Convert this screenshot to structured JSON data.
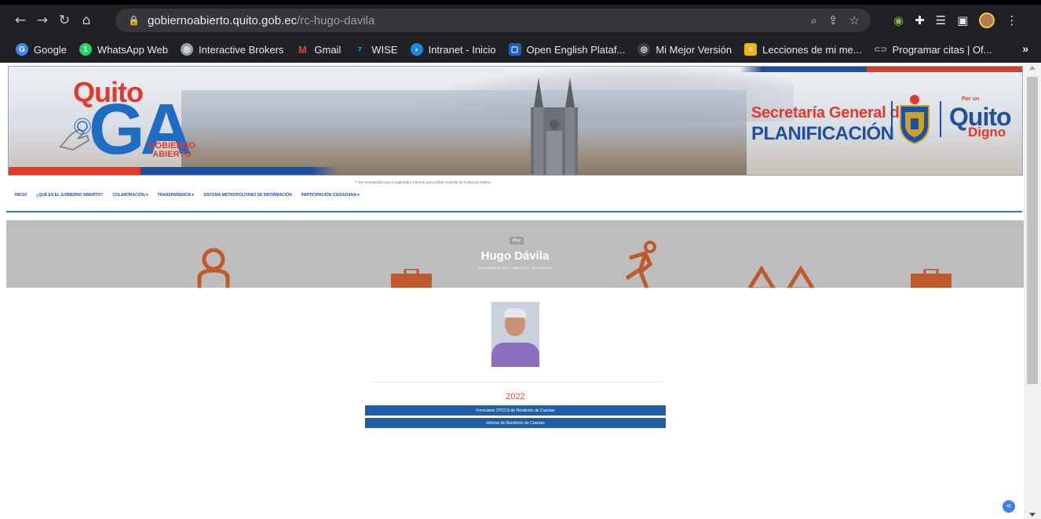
{
  "browser": {
    "url_host": "gobiernoabierto.quito.gob.ec",
    "url_path": "/rc-hugo-davila",
    "bookmarks": [
      {
        "label": "Google",
        "color": "#4285f4"
      },
      {
        "label": "WhatsApp Web",
        "color": "#25d366"
      },
      {
        "label": "Interactive Brokers",
        "color": "#9aa0a6"
      },
      {
        "label": "Gmail",
        "color": "#ea4335"
      },
      {
        "label": "WISE",
        "color": "#00b9ff"
      },
      {
        "label": "Intranet - Inicio",
        "color": "#1e88e5"
      },
      {
        "label": "Open English Plataf...",
        "color": "#1565c0"
      },
      {
        "label": "Mi Mejor Versión",
        "color": "#3c4043"
      },
      {
        "label": "Lecciones de mi me...",
        "color": "#f4b400"
      },
      {
        "label": "Programar citas | Of...",
        "color": "#5f6368"
      }
    ],
    "more_bookmarks": "»"
  },
  "header": {
    "logo_quito": "Quito",
    "logo_ga": "GA",
    "logo_gobierno": "GOBIERNO",
    "logo_abierto": "ABIERTO",
    "secretaria": "Secretaría General de",
    "planificacion": "PLANIFICACIÓN",
    "por_un": "Por un",
    "quito": "Quito",
    "digno": "Digno"
  },
  "notice": "** Se recomienda usar el explorador Chrome para utilizar el portal de Gobierno Abierto",
  "nav": [
    {
      "label": "INICIO"
    },
    {
      "label": "¿QUÉ ES EL GOBIERNO ABIERTO?"
    },
    {
      "label": "COLABORACIÓN ▾"
    },
    {
      "label": "TRANSPARENCIA ▾"
    },
    {
      "label": "SISTEMA METROPOLITANO DE INFORMACIÓN"
    },
    {
      "label": "PARTICIPACIÓN CIUDADANA ▾"
    }
  ],
  "hero": {
    "tag": "Blog",
    "title": "Hugo Dávila",
    "meta": "By Municipio de Quito  ·  6 abril, 2023  ·  No Comments"
  },
  "content": {
    "year": "2022",
    "buttons": [
      {
        "label": "Formulario CPCCS de Rendición de Cuentas"
      },
      {
        "label": "Informe de Rendición de Cuentas"
      }
    ]
  },
  "colors": {
    "brand_blue": "#1e4fa0",
    "brand_red": "#e23a2a",
    "button_blue": "#1f5ea8",
    "hero_gray": "#bdbdbd",
    "hero_icon_orange": "#c2592b"
  },
  "icons": [
    "back-icon",
    "forward-icon",
    "reload-icon",
    "home-icon",
    "lock-icon",
    "zoom-icon",
    "share-icon",
    "star-icon",
    "extensions-icon",
    "puzzle-icon",
    "reading-list-icon",
    "side-panel-icon",
    "profile-avatar-icon",
    "menu-icon",
    "share-fab-icon"
  ]
}
